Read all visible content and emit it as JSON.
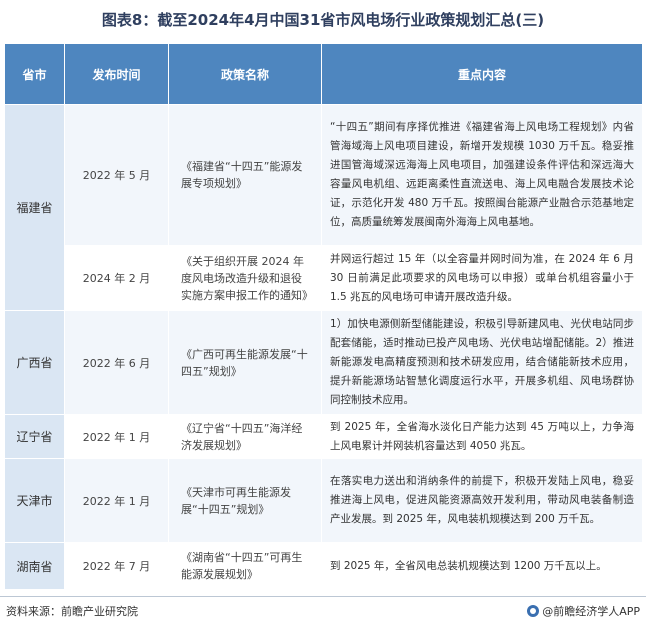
{
  "title": "图表8：截至2024年4月中国31省市风电场行业政策规划汇总(三)",
  "headers": [
    "省市",
    "发布时间",
    "政策名称",
    "重点内容"
  ],
  "rows": [
    {
      "province": "福建省",
      "date": "2022 年 5 月",
      "name": "《福建省“十四五”能源发展专项规划》",
      "content": "“十四五”期间有序择优推进《福建省海上风电场工程规划》内省管海域海上风电项目建设，新增开发规模 1030 万千瓦。稳妥推进国管海域深远海海上风电项目，加强建设条件评估和深远海大容量风电机组、远距离柔性直流送电、海上风电融合发展技术论证，示范化开发 480 万千瓦。按照闽台能源产业融合示范基地定位，高质量统筹发展闽南外海海上风电基地。"
    },
    {
      "province": "",
      "date": "2024 年 2 月",
      "name": "《关于组织开展 2024 年度风电场改造升级和退役实施方案申报工作的通知》",
      "content": "并网运行超过 15 年（以全容量并网时间为准，在 2024 年 6 月 30 日前满足此项要求的风电场可以申报）或单台机组容量小于 1.5 兆瓦的风电场可申请开展改造升级。"
    },
    {
      "province": "广西省",
      "date": "2022 年 6 月",
      "name": "《广西可再生能源发展“十四五”规划》",
      "content": "1）加快电源侧新型储能建设，积极引导新建风电、光伏电站同步配套储能，适时推动已投产风电场、光伏电站增配储能。2）推进新能源发电高精度预测和技术研发应用，结合储能新技术应用，提升新能源场站智慧化调度运行水平，开展多机组、风电场群协同控制技术应用。"
    },
    {
      "province": "辽宁省",
      "date": "2022 年 1 月",
      "name": "《辽宁省“十四五”海洋经济发展规划》",
      "content": "到 2025 年，全省海水淡化日产能力达到 45 万吨以上，力争海上风电累计并网装机容量达到 4050 兆瓦。"
    },
    {
      "province": "天津市",
      "date": "2022 年 1 月",
      "name": "《天津市可再生能源发展“十四五”规划》",
      "content": "在落实电力送出和消纳条件的前提下，积极开发陆上风电，稳妥推进海上风电，促进风能资源高效开发利用，带动风电装备制造产业发展。到 2025 年，风电装机规模达到 200 万千瓦。"
    },
    {
      "province": "湖南省",
      "date": "2022 年 7 月",
      "name": "《湖南省“十四五”可再生能源发展规划》",
      "content": "到 2025 年，全省风电总装机规模达到 1200 万千瓦以上。"
    }
  ],
  "footer": {
    "source": "资料来源：前瞻产业研究院",
    "brand": "@前瞻经济学人APP"
  }
}
